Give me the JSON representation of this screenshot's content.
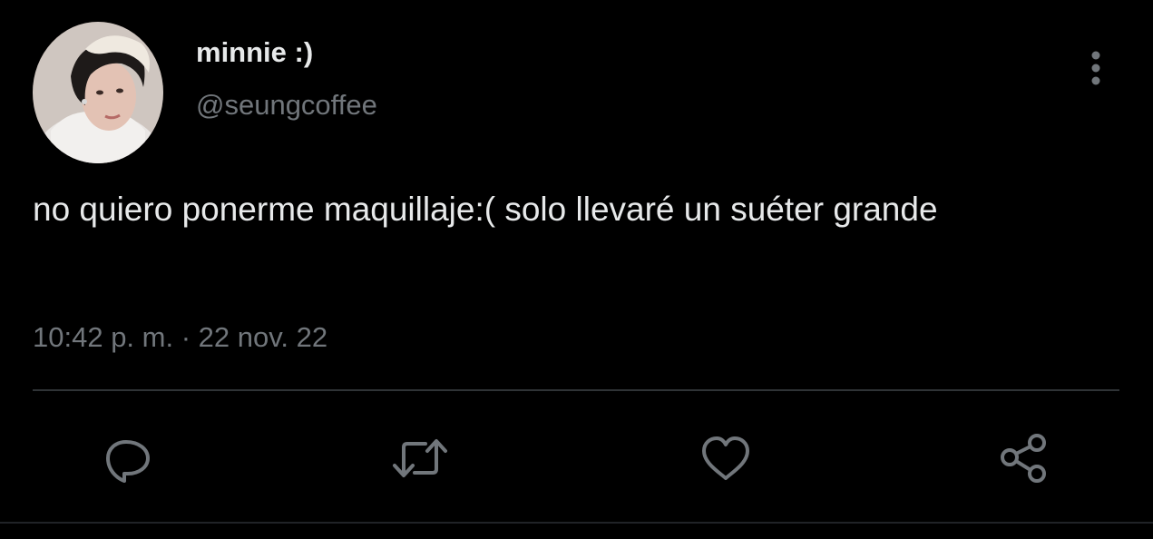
{
  "tweet": {
    "author": {
      "display_name": "minnie :)",
      "handle": "@seungcoffee"
    },
    "text": "no quiero ponerme maquillaje:( solo llevaré un suéter grande",
    "timestamp": "10:42 p. m. · 22 nov. 22",
    "actions": {
      "reply": "reply-icon",
      "retweet": "retweet-icon",
      "like": "heart-icon",
      "share": "share-icon"
    }
  },
  "colors": {
    "background": "#000000",
    "primary_text": "#e7e9ea",
    "secondary_text": "#71767b",
    "divider": "#2f3336"
  }
}
